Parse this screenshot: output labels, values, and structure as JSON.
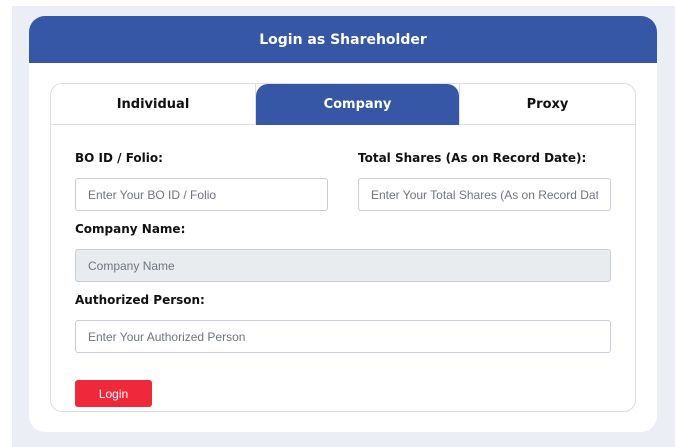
{
  "header": {
    "title": "Login as Shareholder"
  },
  "tabs": [
    {
      "label": "Individual",
      "active": false
    },
    {
      "label": "Company",
      "active": true
    },
    {
      "label": "Proxy",
      "active": false
    }
  ],
  "form": {
    "bo_id": {
      "label": "BO ID / Folio:",
      "placeholder": "Enter Your BO ID / Folio",
      "value": ""
    },
    "total_shares": {
      "label": "Total Shares (As on Record Date):",
      "placeholder": "Enter Your Total Shares (As on Record Date)",
      "value": ""
    },
    "company_name": {
      "label": "Company Name:",
      "placeholder": "Company Name",
      "value": ""
    },
    "authorized_person": {
      "label": "Authorized Person:",
      "placeholder": "Enter Your Authorized Person",
      "value": ""
    },
    "submit_label": "Login"
  },
  "colors": {
    "primary": "#3656a6",
    "danger": "#f0293a",
    "page_background": "#eceef6"
  }
}
